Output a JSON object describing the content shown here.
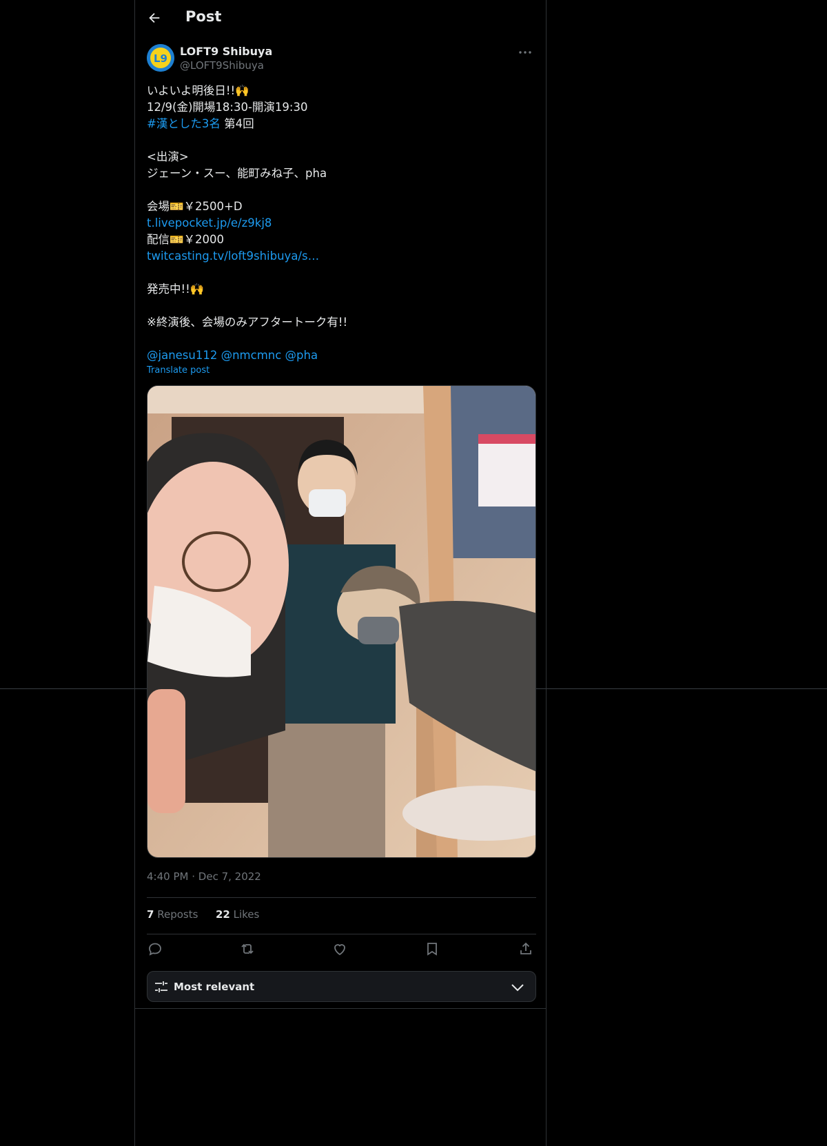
{
  "header": {
    "title": "Post"
  },
  "author": {
    "display_name": "LOFT9 Shibuya",
    "handle": "@LOFT9Shibuya",
    "avatar_text": "L9"
  },
  "post": {
    "lines": [
      [
        "いよいよ明後日!!🙌"
      ],
      [
        "12/9(金)開場18:30-開演19:30"
      ],
      [
        "#漢とした3名",
        " 第4回"
      ],
      [
        ""
      ],
      [
        "<出演>"
      ],
      [
        "ジェーン・スー、能町みね子、pha"
      ],
      [
        ""
      ],
      [
        "会場🎫￥2500+D"
      ],
      [
        "t.livepocket.jp/e/z9kj8"
      ],
      [
        "配信🎫￥2000"
      ],
      [
        "twitcasting.tv/loft9shibuya/s…"
      ],
      [
        ""
      ],
      [
        "発売中!!🙌"
      ],
      [
        ""
      ],
      [
        "※終演後、会場のみアフタートーク有!!"
      ],
      [
        ""
      ],
      [
        "@janesu112 @nmcmnc @pha"
      ]
    ],
    "translate": "Translate post",
    "time": "4:40 PM",
    "dot": "·",
    "date": "Dec 7, 2022"
  },
  "stats": {
    "reposts_count": "7",
    "reposts_label": "Reposts",
    "likes_count": "22",
    "likes_label": "Likes"
  },
  "sort": {
    "label": "Most relevant"
  },
  "colors": {
    "link": "#1d9bf0",
    "text": "#e7e9ea",
    "muted": "#71767b",
    "border": "#2f3336"
  }
}
